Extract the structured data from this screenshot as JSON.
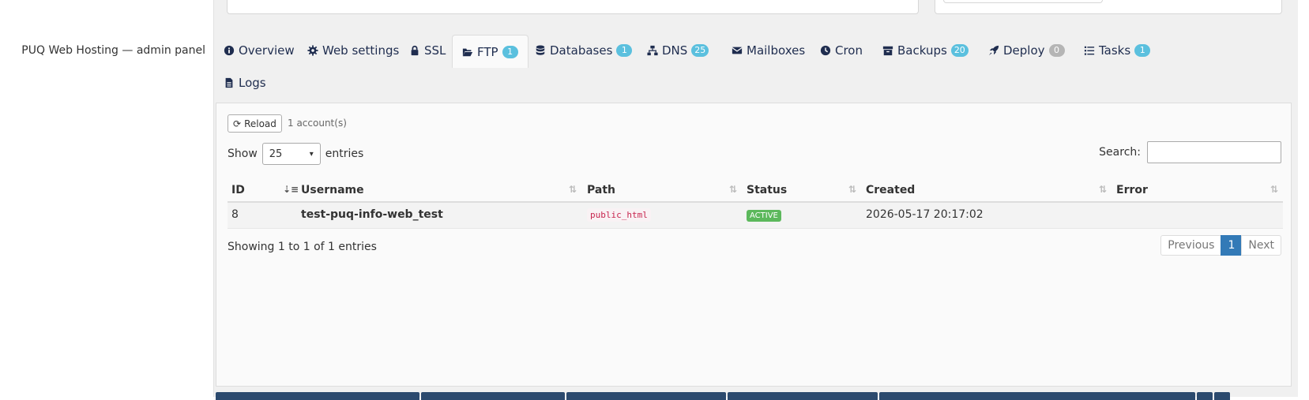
{
  "panel_label": "PUQ Web Hosting — admin panel",
  "tabs": [
    {
      "label": "Overview",
      "icon": "info-circle-icon",
      "badge": null
    },
    {
      "label": "Web settings",
      "icon": "gear-icon",
      "badge": null
    },
    {
      "label": "SSL",
      "icon": "lock-icon",
      "badge": null
    },
    {
      "label": "FTP",
      "icon": "folder-open-icon",
      "badge": "1",
      "active": true
    },
    {
      "label": "Databases",
      "icon": "database-icon",
      "badge": "1"
    },
    {
      "label": "DNS",
      "icon": "sitemap-icon",
      "badge": "25"
    },
    {
      "label": "Mailboxes",
      "icon": "envelope-icon",
      "badge": null
    },
    {
      "label": "Cron",
      "icon": "clock-icon",
      "badge": null
    },
    {
      "label": "Backups",
      "icon": "archive-icon",
      "badge": "20"
    },
    {
      "label": "Deploy",
      "icon": "rocket-icon",
      "badge": "0"
    },
    {
      "label": "Tasks",
      "icon": "list-icon",
      "badge": "1"
    },
    {
      "label": "Logs",
      "icon": "file-icon",
      "badge": null
    }
  ],
  "toolbar": {
    "reload_label": "Reload",
    "count_text": "1 account(s)"
  },
  "length": {
    "show_label": "Show",
    "selected": "25",
    "entries_label": "entries"
  },
  "search": {
    "label": "Search:",
    "value": ""
  },
  "table": {
    "columns": [
      "ID",
      "Username",
      "Path",
      "Status",
      "Created",
      "Error"
    ],
    "rows": [
      {
        "id": "8",
        "username": "test-puq-info-web_test",
        "path": "public_html",
        "status": "ACTIVE",
        "created": "2026-05-17 20:17:02",
        "error": ""
      }
    ]
  },
  "footer": {
    "info": "Showing 1 to 1 of 1 entries",
    "previous": "Previous",
    "current_page": "1",
    "next": "Next"
  },
  "colors": {
    "accent": "#337ab7",
    "badge": "#5bc0de",
    "status_active": "#5cb85c",
    "nav_text": "#1f2d4f"
  }
}
